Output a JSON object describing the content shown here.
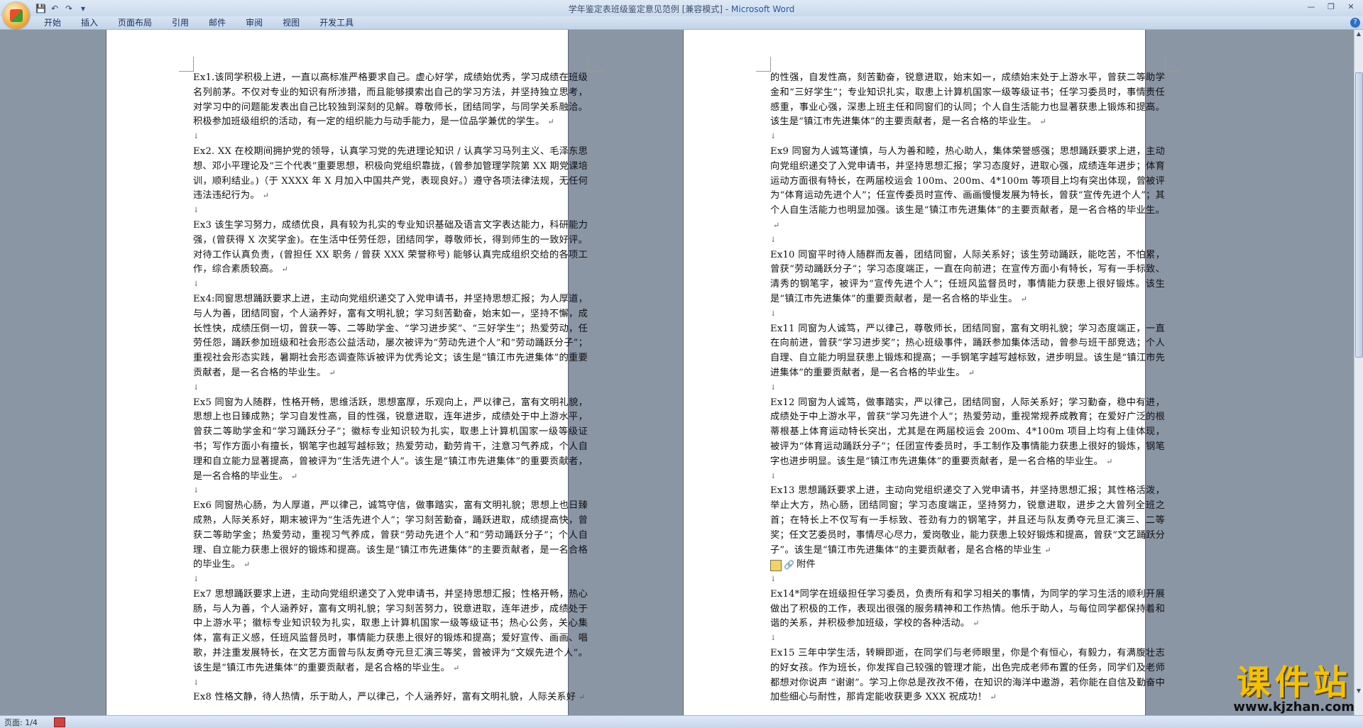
{
  "window": {
    "title": "学年鉴定表班级鉴定意见范例 [兼容模式] - ",
    "app": "Microsoft Word",
    "controls": [
      "—",
      "❐",
      "✕"
    ]
  },
  "quick_access": [
    "💾",
    "↶",
    "↷",
    "▾"
  ],
  "ribbon": {
    "tabs": [
      "开始",
      "插入",
      "页面布局",
      "引用",
      "邮件",
      "审阅",
      "视图",
      "开发工具"
    ],
    "help": "?"
  },
  "page1": {
    "paragraphs": [
      "Ex1.该同学积极上进，一直以高标准严格要求自己。虚心好学，成绩始优秀，学习成绩在班级名列前茅。不仅对专业的知识有所涉猎，而且能够摸索出自己的学习方法，并坚持独立思考，对学习中的问题能发表出自己比较独到深刻的见解。尊敬师长，团结同学，与同学关系融洽。积极参加班级组织的活动，有一定的组织能力与动手能力，是一位品学兼优的学生。",
      "",
      "Ex2. XX 在校期间拥护党的领导，认真学习党的先进理论知识 / 认真学习马列主义、毛泽东思想、邓小平理论及“三个代表”重要思想，积极向党组织靠拢，(曾参加管理学院第 XX 期党课培训，顺利结业。)（于 XXXX 年 X 月加入中国共产党，表现良好。）遵守各项法律法规，无任何违法违纪行为。",
      "",
      "Ex3 该生学习努力，成绩优良，具有较为扎实的专业知识基础及语言文字表达能力，科研能力强，(曾获得 X 次奖学金)。在生活中任劳任怨，团结同学，尊敬师长，得到师生的一致好评。对待工作认真负责，(曾担任 XX 职务 / 曾获 XXX 荣誉称号) 能够认真完成组织交给的各项工作，综合素质较高。",
      "",
      "Ex4:同窗思想踊跃要求上进，主动向党组织递交了入党申请书，并坚持思想汇报；为人厚道，与人为善，团结同窗，个人涵养好，富有文明礼貌；学习刻苦勤奋，始末如一，坚持不懈，成长性快，成绩压倒一切，曾获一等、二等助学金、“学习进步奖”、“三好学生”；热爱劳动，任劳任怨，踊跃参加班级和社会形态公益活动，屡次被评为“劳动先进个人”和“劳动踊跃分子”；重视社会形态实践，暑期社会形态调查陈诉被评为优秀论文；该生是“镇江市先进集体”的重要贡献者，是一名合格的毕业生。",
      "",
      "Ex5 同窗为人随群，性格开畅，思维活跃，思想富厚，乐观向上，严以律己，富有文明礼貌，思想上也日臻成熟；学习自发性高，目的性强，锐意进取，连年进步，成绩处于中上游水平，曾获二等助学金和“学习踊跃分子”；徽标专业知识较为扎实，取患上计算机国家一级等级证书；写作方面小有擅长，钢笔字也越写越标致；热爱劳动，勤劳肯干，注意习气养成，个人自理和自立能力显著提高，曾被评为“生活先进个人”。该生是“镇江市先进集体”的重要贡献者，是一名合格的毕业生。",
      "",
      "Ex6 同窗热心肠，为人厚道，严以律己，诚笃守信，做事踏实，富有文明礼貌；思想上也日臻成熟，人际关系好，期末被评为“生活先进个人”；学习刻苦勤奋，踊跃进取，成绩提高快，曾获二等助学金；热爱劳动，重视习气养成，曾获“劳动先进个人”和“劳动踊跃分子”；个人自理、自立能力获患上很好的锻炼和提高。该生是“镇江市先进集体”的主要贡献者，是一名合格的毕业生。",
      "",
      "Ex7 思想踊跃要求上进，主动向党组织递交了入党申请书，并坚持思想汇报；性格开畅，热心肠，与人为善，个人涵养好，富有文明礼貌；学习刻苦努力，锐意进取，连年进步，成绩处于中上游水平；徽标专业知识较为扎实，取患上计算机国家一级等级证书；热心公务，关心集体，富有正义感，任班风监督员时，事情能力获患上很好的锻炼和提高；爱好宣传、画画、唱歌，并注重发展特长，在文艺方面曾与队友勇夺元旦汇演三等奖，曾被评为“文娱先进个人”。该生是“镇江市先进集体”的重要贡献者，是名合格的毕业生。",
      "",
      "Ex8 性格文静，待人热情，乐于助人，严以律己，个人涵养好，富有文明礼貌，人际关系好"
    ]
  },
  "page2": {
    "paragraphs": [
      "的性强，自发性高，刻苦勤奋，锐意进取，始末如一，成绩始末处于上游水平，曾获二等助学金和“三好学生”；专业知识扎实，取患上计算机国家一级等级证书；任学习委员时，事情责任感重，事业心强，深患上班主任和同窗们的认同；个人自生活能力也显著获患上锻炼和提高。该生是“镇江市先进集体”的主要贡献者，是一名合格的毕业生。",
      "",
      "Ex9 同窗为人诚笃谨慎，与人为善和睦，热心助人，集体荣誉感强；思想踊跃要求上进，主动向党组织递交了入党申请书，并坚持思想汇报；学习态度好，进取心强，成绩连年进步；体育运动方面很有特长，在两届校运会 100m、200m、4*100m 等项目上均有突出体现，曾被评为“体育运动先进个人”；任宣传委员时宣传、画画慢慢发展为特长，曾获“宣传先进个人”；其个人自生活能力也明显加强。该生是“镇江市先进集体”的主要贡献者，是一名合格的毕业生。",
      "",
      "Ex10 同窗平时待人随群而友善，团结同窗，人际关系好；该生劳动踊跃，能吃苦，不怕累，曾获“劳动踊跃分子”；学习态度端正，一直在向前进；在宣传方面小有特长，写有一手标致、清秀的钢笔字，被评为“宣传先进个人”；任班风监督员时，事情能力获患上很好锻炼。该生是“镇江市先进集体”的重要贡献者，是一名合格的毕业生。",
      "",
      "Ex11 同窗为人诚笃，严以律己，尊敬师长，团结同窗，富有文明礼貌；学习态度端正，一直在向前进，曾获“学习进步奖”；热心班级事件，踊跃参加集体活动，曾参与班干部竞选；个人自理、自立能力明显获患上锻炼和提高；一手钢笔字越写越标致，进步明显。该生是“镇江市先进集体”的重要贡献者，是一名合格的毕业生。",
      "",
      "Ex12 同窗为人诚笃，做事踏实，严以律己，团结同窗，人际关系好；学习勤奋，稳中有进，成绩处于中上游水平，曾获“学习先进个人”；热爱劳动，重视常规养成教育；在爱好广泛的根蒂根基上体育运动特长突出，尤其是在两届校运会 200m、4*100m 项目上均有上佳体现，被评为“体育运动踊跃分子”；任团宣传委员时，手工制作及事情能力获患上很好的锻炼，钢笔字也进步明显。该生是“镇江市先进集体”的重要贡献者，是一名合格的毕业生。",
      "",
      "Ex13 思想踊跃要求上进，主动向党组织递交了入党申请书，并坚持思想汇报；其性格活泼，举止大方，热心肠，团结同窗；学习态度端正，坚持努力，锐意进取，进步之大曾列全班之首；在特长上不仅写有一手标致、苍劲有力的钢笔字，并且还与队友勇夺元旦汇演三、二等奖；任文艺委员时，事情尽心尽力，爱岗敬业，能力获患上较好锻炼和提高，曾获“文艺踊跃分子”。该生是“镇江市先进集体”的主要贡献者，是名合格的毕业生"
    ],
    "attachment_label": "附件",
    "paragraphs_after": [
      "",
      "Ex14*同学在班级担任学习委员，负责所有和学习相关的事情，为同学的学习生活的顺利开展做出了积极的工作，表现出很强的服务精神和工作热情。他乐于助人，与每位同学都保持着和谐的关系，并积极参加班级，学校的各种活动。",
      "",
      "Ex15 三年中学生活，转瞬即逝，在同学们与老师眼里，你是个有恒心，有毅力，有满腹壮志的好女孩。作为班长，你发挥自己较强的管理才能，出色完成老师布置的任务，同学们及老师都想对你说声 “谢谢”。学习上你总是孜孜不倦，在知识的海洋中遨游，若你能在自信及勤奋中加些细心与耐性，那肯定能收获更多 XXX 祝成功！"
    ]
  },
  "status": {
    "page": "页面: 1/4"
  },
  "watermark": {
    "title": "课件站",
    "url": "www.kjzhan.com"
  }
}
